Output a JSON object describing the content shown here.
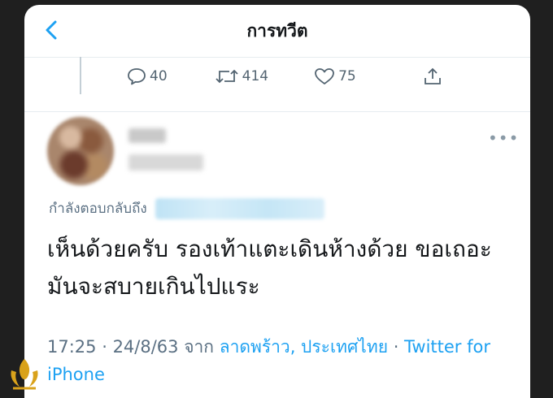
{
  "header": {
    "title": "การทวีต"
  },
  "actions": {
    "reply_count": "40",
    "retweet_count": "414",
    "like_count": "75"
  },
  "reply": {
    "replying_to_label": "กำลังตอบกลับถึง",
    "text": "เห็นด้วยครับ รองเท้าแตะเดินห้างด้วย ขอเถอะ มันจะสบายเกินไปแระ"
  },
  "meta": {
    "time": "17:25",
    "sep1": " · ",
    "date": "24/8/63",
    "from_word": " จาก ",
    "location": "ลาดพร้าว, ประเทศไทย",
    "sep2": " · ",
    "client": "Twitter for iPhone"
  },
  "colors": {
    "accent": "#1da1f2",
    "muted": "#5b7083",
    "text": "#14171a"
  }
}
